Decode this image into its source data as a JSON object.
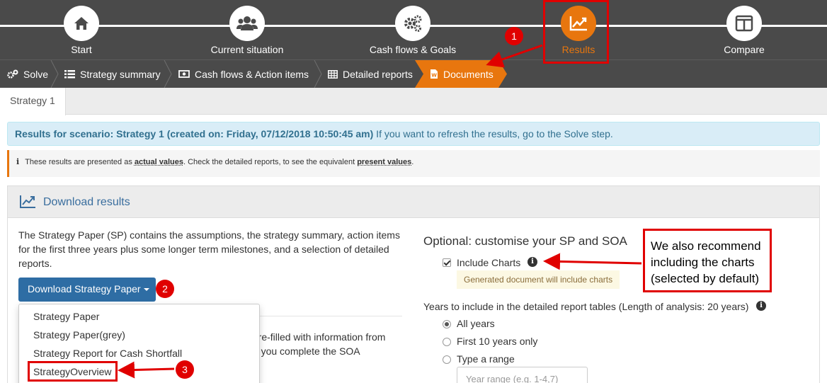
{
  "steps": [
    {
      "label": "Start",
      "icon": "home-icon"
    },
    {
      "label": "Current situation",
      "icon": "users-icon"
    },
    {
      "label": "Cash flows & Goals",
      "icon": "gears-icon"
    },
    {
      "label": "Results",
      "icon": "trend-chart-icon"
    },
    {
      "label": "Compare",
      "icon": "columns-icon"
    }
  ],
  "crumbs": {
    "solve": "Solve",
    "strategy_summary": "Strategy summary",
    "cashflows_action": "Cash flows & Action items",
    "detailed_reports": "Detailed reports",
    "documents": "Documents"
  },
  "tabs": {
    "strategy1": "Strategy 1"
  },
  "results_info": {
    "bold": "Results for scenario: Strategy 1 (created on: Friday, 07/12/2018 10:50:45 am)",
    "rest": " If you want to refresh the results, go to the Solve step."
  },
  "note": {
    "part1": "These results are presented as ",
    "actual": "actual values",
    "part2": ". Check the detailed reports, to see the equivalent ",
    "present": "present values",
    "part3": "."
  },
  "panel": {
    "title": "Download results"
  },
  "description": "The Strategy Paper (SP) contains the assumptions, the strategy summary, action items for the first three years plus some longer term milestones, and a selection of detailed reports.",
  "download_button": "Download Strategy Paper",
  "menu_items": [
    "Strategy Paper",
    "Strategy Paper(grey)",
    "Strategy Report for Cash Shortfall",
    "StrategyOverview"
  ],
  "behind_text": {
    "line1": "s pre-filled with information from",
    "line2": "elp you complete the SOA"
  },
  "optional": {
    "title": "Optional: customise your SP and SOA",
    "include_charts": "Include Charts",
    "charts_hint": "Generated document will include charts",
    "years_label": "Years to include in the detailed report tables (Length of analysis: 20 years)",
    "radios": [
      "All years",
      "First 10 years only",
      "Type a range"
    ],
    "range_placeholder": "Year range (e.g. 1-4,7)"
  },
  "annotations": {
    "badge1": "1",
    "badge2": "2",
    "badge3": "3",
    "callout": "We also recommend including the charts (selected by default)"
  },
  "colors": {
    "accent": "#e8760e",
    "primary": "#2e6da4",
    "annotation": "#e00000",
    "dark": "#4a4a4a"
  }
}
